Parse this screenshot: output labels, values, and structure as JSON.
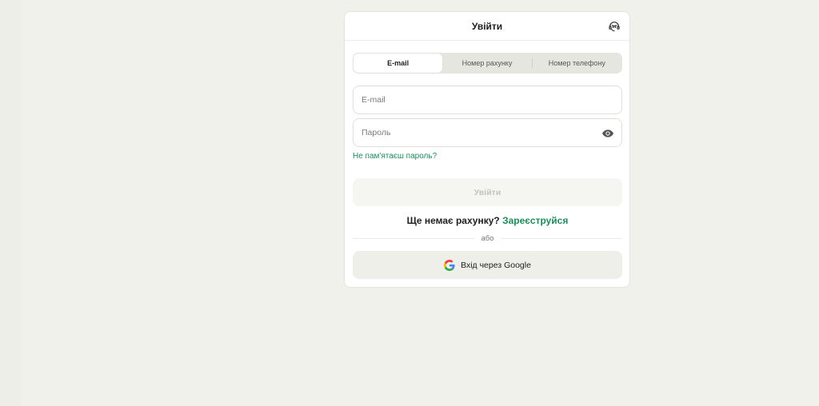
{
  "header": {
    "title": "Увійти",
    "support_icon": "support-agent-icon"
  },
  "tabs": [
    {
      "label": "E-mail",
      "active": true
    },
    {
      "label": "Номер рахунку",
      "active": false
    },
    {
      "label": "Номер телефону",
      "active": false
    }
  ],
  "form": {
    "email_placeholder": "E-mail",
    "email_value": "",
    "password_placeholder": "Пароль",
    "password_value": "",
    "forgot_label": "Не пам'ятаєш пароль?",
    "login_label": "Увійти"
  },
  "register": {
    "prompt": "Ще немає рахунку?",
    "link": "Зареєструйся"
  },
  "divider_label": "або",
  "google": {
    "label": "Вхід через Google",
    "icon": "google-icon"
  },
  "colors": {
    "accent": "#1f8a5e",
    "background": "#f1f1ec",
    "disabled_text": "#c3c3be"
  }
}
